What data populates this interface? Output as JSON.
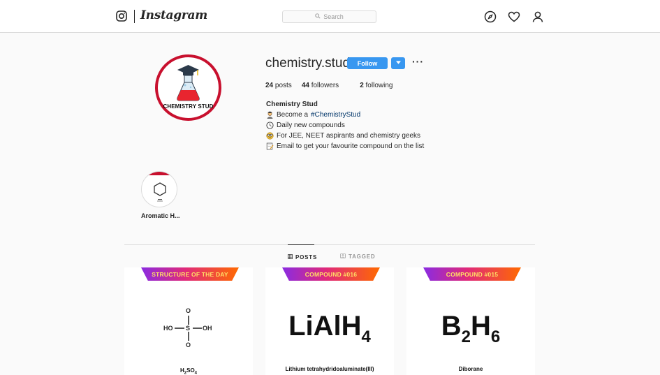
{
  "header": {
    "wordmark": "Instagram",
    "search_placeholder": "Search",
    "icons": [
      "instagram-glyph-icon",
      "search-icon",
      "explore-compass-icon",
      "heart-icon",
      "profile-icon"
    ]
  },
  "profile": {
    "username": "chemistry.stud",
    "follow_label": "Follow",
    "avatar_text": "CHEMISTRY STUD",
    "stats": {
      "posts_count": "24",
      "posts_label": "posts",
      "followers_count": "44",
      "followers_label": "followers",
      "following_count": "2",
      "following_label": "following"
    },
    "bio": {
      "name": "Chemistry Stud",
      "line1_prefix": "Become a",
      "line1_hashtag": "#ChemistryStud",
      "line2": "Daily new compounds",
      "line3": "For JEE, NEET aspirants and chemistry geeks",
      "line4": "Email to get your favourite compound on the list"
    }
  },
  "highlights": [
    {
      "label": "Aromatic H..."
    }
  ],
  "tabs": [
    {
      "label": "POSTS",
      "active": true
    },
    {
      "label": "TAGGED",
      "active": false
    }
  ],
  "posts": [
    {
      "banner": "STRUCTURE OF THE DAY",
      "structure": {
        "top": "O",
        "left": "HO",
        "center": "S",
        "right": "OH",
        "bottom": "O"
      },
      "caption_main": "H",
      "caption_sub1": "2",
      "caption_mid": "SO",
      "caption_sub2": "4"
    },
    {
      "banner": "COMPOUND #016",
      "formula_main": "LiAlH",
      "formula_sub": "4",
      "caption": "Lithium tetrahydridoaluminate(III)"
    },
    {
      "banner": "COMPOUND #015",
      "formula_a": "B",
      "formula_sub_a": "2",
      "formula_b": "H",
      "formula_sub_b": "6",
      "caption": "Diborane"
    }
  ],
  "colors": {
    "accent_blue": "#3897f0",
    "avatar_ring": "#c8102e",
    "banner_text": "#ffe066"
  }
}
